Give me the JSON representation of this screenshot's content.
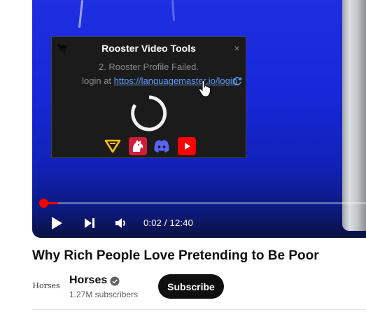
{
  "player": {
    "progress_fraction": 0.003,
    "time_display": "0:02 / 12:40",
    "controls": [
      "play-icon",
      "next-icon",
      "volume-icon"
    ],
    "colors": {
      "background": "#1628d8",
      "progress": "#ff0000"
    }
  },
  "popup": {
    "title": "Rooster Video Tools",
    "close_label": "×",
    "status": "2. Rooster Profile Failed.",
    "login_prefix": "login at ",
    "login_link": "https://languagemaster.io/login",
    "icons": [
      "rooster-logo-icon",
      "refresh-icon",
      "loading-spinner-icon"
    ],
    "social_links": [
      "languagemaster-icon",
      "rooster-app-icon",
      "discord-icon",
      "youtube-icon"
    ],
    "colors": {
      "background": "#1b1b1b",
      "link": "#5e9cf5",
      "status_text": "#8c8c8c"
    }
  },
  "video": {
    "title": "Why Rich People Love Pretending to Be Poor"
  },
  "channel": {
    "avatar_text": "Horses",
    "name": "Horses",
    "verified": true,
    "subscribers": "1.27M subscribers",
    "subscribe_label": "Subscribe"
  }
}
